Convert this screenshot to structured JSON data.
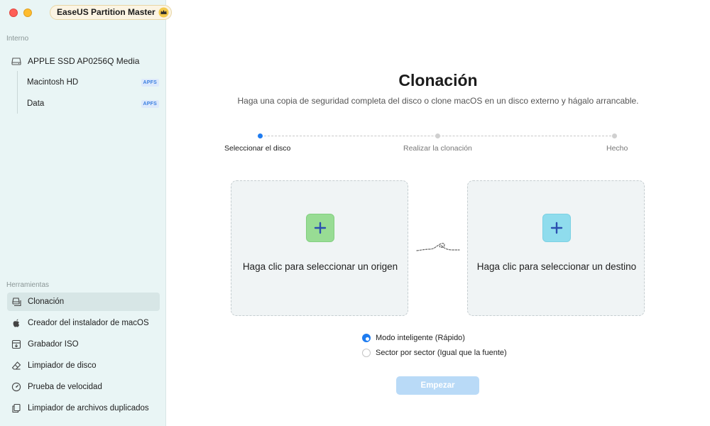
{
  "window": {
    "traffic_colors": {
      "close": "#fe5f57",
      "minimize": "#febc2e"
    },
    "brand": "EaseUS Partition Master"
  },
  "sidebar": {
    "internal_label": "Interno",
    "disk": {
      "name": "APPLE SSD AP0256Q Media",
      "icon": "drive-icon"
    },
    "partitions": [
      {
        "name": "Macintosh HD",
        "fs": "APFS"
      },
      {
        "name": "Data",
        "fs": "APFS"
      }
    ],
    "tools_label": "Herramientas",
    "tools": [
      {
        "label": "Clonación",
        "icon": "clone-icon",
        "active": true
      },
      {
        "label": "Creador del instalador de macOS",
        "icon": "apple-icon"
      },
      {
        "label": "Grabador ISO",
        "icon": "iso-burner-icon"
      },
      {
        "label": "Limpiador de disco",
        "icon": "eraser-icon"
      },
      {
        "label": "Prueba de velocidad",
        "icon": "speedometer-icon"
      },
      {
        "label": "Limpiador de archivos duplicados",
        "icon": "duplicate-files-icon"
      }
    ]
  },
  "main": {
    "title": "Clonación",
    "subtitle": "Haga una copia de seguridad completa del disco o clone macOS en un disco externo y hágalo arrancable.",
    "steps": [
      {
        "label": "Seleccionar el disco",
        "active": true
      },
      {
        "label": "Realizar la clonación",
        "active": false
      },
      {
        "label": "Hecho",
        "active": false
      }
    ],
    "source_card": {
      "text": "Haga clic para seleccionar un origen",
      "icon": "plus-icon"
    },
    "target_card": {
      "text": "Haga clic para seleccionar un destino",
      "icon": "plus-icon"
    },
    "modes": [
      {
        "label": "Modo inteligente (Rápido)",
        "checked": true
      },
      {
        "label": "Sector por sector (Igual que la fuente)",
        "checked": false
      }
    ],
    "start_button": "Empezar",
    "accent_color": "#1f7cf0"
  }
}
